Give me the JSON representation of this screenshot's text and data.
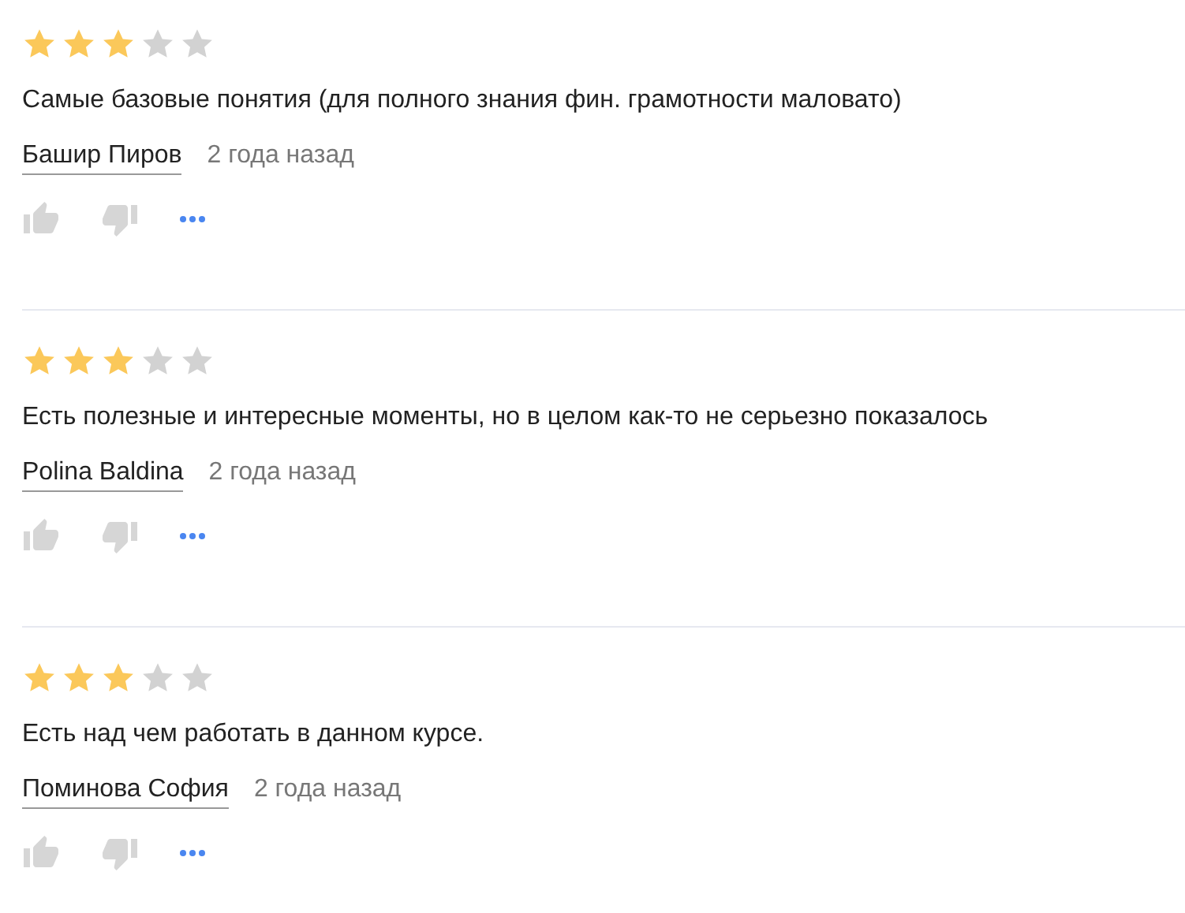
{
  "reviews": [
    {
      "stars": 3,
      "text": "Самые базовые понятия (для полного знания фин. грамотности маловато)",
      "author": "Башир Пиров",
      "time": "2 года назад"
    },
    {
      "stars": 3,
      "text": "Есть полезные и интересные моменты, но в целом как-то не серьезно показалось",
      "author": "Polina Baldina",
      "time": "2 года назад"
    },
    {
      "stars": 3,
      "text": "Есть над чем работать в данном курсе.",
      "author": "Поминова София",
      "time": "2 года назад"
    }
  ]
}
